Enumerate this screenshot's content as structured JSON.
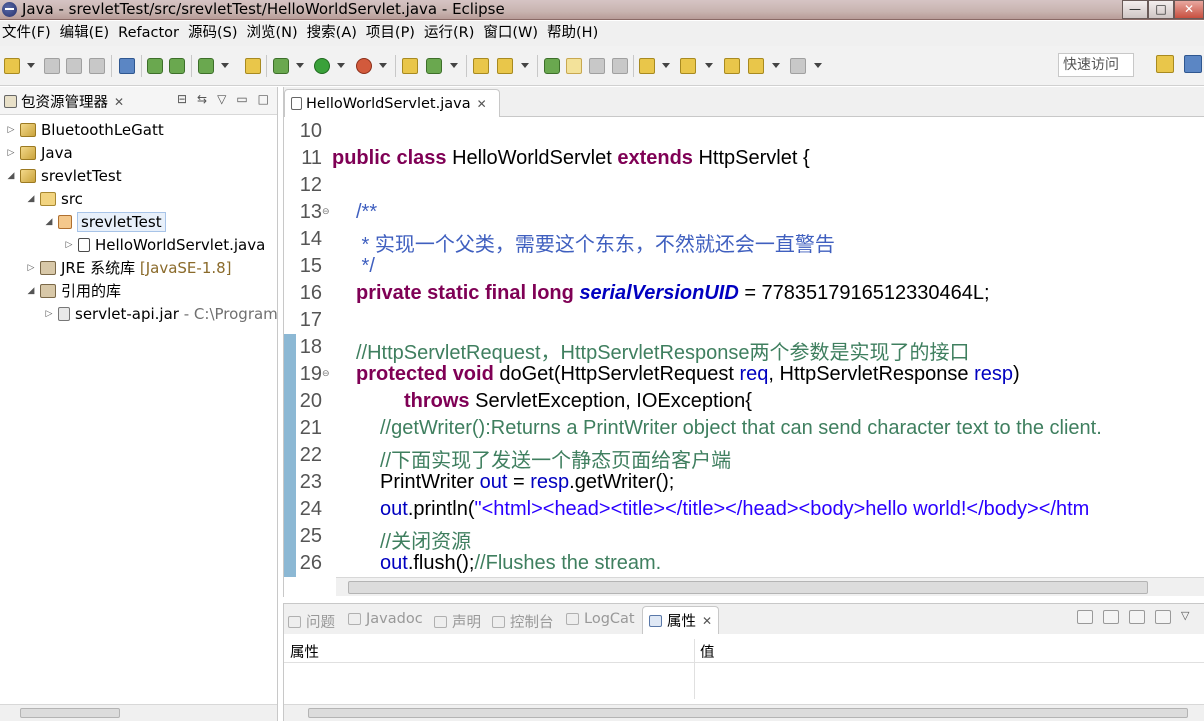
{
  "window": {
    "title": "Java  -  srevletTest/src/srevletTest/HelloWorldServlet.java  -  Eclipse",
    "buttons": [
      "—",
      "□",
      "✕"
    ]
  },
  "menu": [
    "文件(F)",
    "编辑(E)",
    "Refactor",
    "源码(S)",
    "浏览(N)",
    "搜索(A)",
    "项目(P)",
    "运行(R)",
    "窗口(W)",
    "帮助(H)"
  ],
  "toolbar": {
    "quick_access": "快速访问"
  },
  "package_explorer": {
    "title": "包资源管理器",
    "items": [
      {
        "label": "BluetoothLeGatt",
        "level": 0,
        "expanded": false
      },
      {
        "label": "Java",
        "level": 0,
        "expanded": false
      },
      {
        "label": "srevletTest",
        "level": 0,
        "expanded": true
      },
      {
        "label": "src",
        "level": 1,
        "expanded": true
      },
      {
        "label": "srevletTest",
        "level": 2,
        "expanded": true,
        "selected": true
      },
      {
        "label": "HelloWorldServlet.java",
        "level": 3,
        "expanded": false
      },
      {
        "label": "JRE 系统库",
        "extra": "[JavaSE-1.8]",
        "level": 1,
        "expanded": false
      },
      {
        "label": "引用的库",
        "level": 1,
        "expanded": true
      },
      {
        "label": "servlet-api.jar",
        "extra": "- C:\\Program",
        "level": 2,
        "expanded": false
      }
    ]
  },
  "editor": {
    "tab": "HelloWorldServlet.java",
    "lines": [
      {
        "n": "10",
        "t": ""
      },
      {
        "n": "11",
        "t": "public class HelloWorldServlet extends HttpServlet {"
      },
      {
        "n": "12",
        "t": ""
      },
      {
        "n": "13",
        "t": "/**"
      },
      {
        "n": "14",
        "t": " * 实现一个父类，需要这个东东，不然就还会一直警告"
      },
      {
        "n": "15",
        "t": " */"
      },
      {
        "n": "16",
        "t": "private static final long serialVersionUID = 7783517916512330464L;"
      },
      {
        "n": "17",
        "t": ""
      },
      {
        "n": "18",
        "t": "//HttpServletRequest，HttpServletResponse两个参数是实现了的接口"
      },
      {
        "n": "19",
        "t": "protected void doGet(HttpServletRequest req, HttpServletResponse resp)"
      },
      {
        "n": "20",
        "t": "throws ServletException, IOException{"
      },
      {
        "n": "21",
        "t": "//getWriter():Returns a PrintWriter object that can send character text to the client."
      },
      {
        "n": "22",
        "t": "//下面实现了发送一个静态页面给客户端"
      },
      {
        "n": "23",
        "t": "PrintWriter out = resp.getWriter();"
      },
      {
        "n": "24",
        "t": "out.println(\"<html><head><title></title></head><body>hello world!</body></htm"
      },
      {
        "n": "25",
        "t": "//关闭资源"
      },
      {
        "n": "26",
        "t": "out.flush();//Flushes the stream."
      }
    ]
  },
  "bottom_views": {
    "tabs": [
      "问题",
      "Javadoc",
      "声明",
      "控制台",
      "LogCat",
      "属性"
    ],
    "active_tab": "属性",
    "columns": [
      "属性",
      "值"
    ]
  }
}
